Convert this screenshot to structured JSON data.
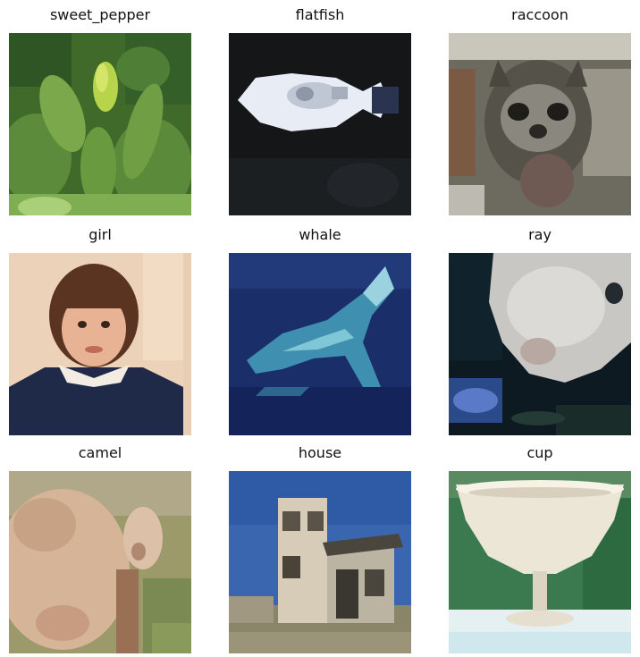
{
  "grid": {
    "items": [
      {
        "label": "sweet_pepper"
      },
      {
        "label": "flatfish"
      },
      {
        "label": "raccoon"
      },
      {
        "label": "girl"
      },
      {
        "label": "whale"
      },
      {
        "label": "ray"
      },
      {
        "label": "camel"
      },
      {
        "label": "house"
      },
      {
        "label": "cup"
      }
    ]
  },
  "colors": {
    "background": "#ffffff",
    "title_text": "#111111"
  }
}
